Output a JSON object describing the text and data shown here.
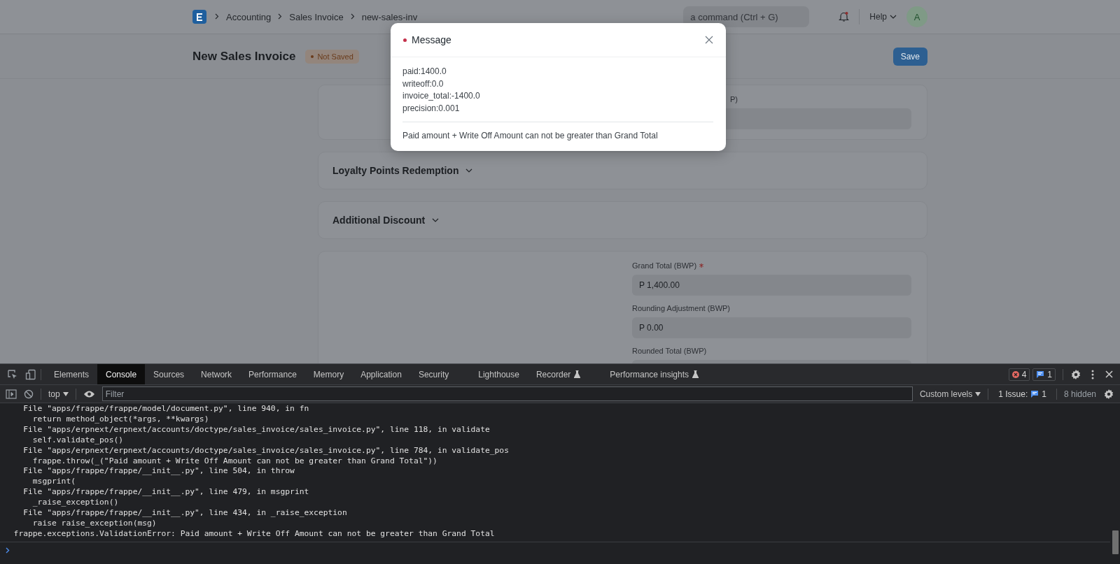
{
  "topbar": {
    "breadcrumbs": [
      "Accounting",
      "Sales Invoice",
      "new-sales-inv"
    ],
    "search": {
      "placeholder": "a command (Ctrl + G)"
    },
    "help": "Help",
    "avatar": "A"
  },
  "page_head": {
    "title": "New Sales Invoice",
    "status": "Not Saved",
    "save": "Save"
  },
  "sections": [
    {
      "kind": "fields",
      "fields": [
        {
          "label": "P)",
          "required": false
        }
      ]
    },
    {
      "kind": "collapsible",
      "title": "Loyalty Points Redemption",
      "expanded": false
    },
    {
      "kind": "collapsible",
      "title": "Additional Discount",
      "expanded": false
    },
    {
      "kind": "fields",
      "fields": [
        {
          "label": "Grand Total (BWP)",
          "required": true,
          "value": "P 1,400.00"
        },
        {
          "label": "Rounding Adjustment (BWP)",
          "required": false,
          "value": "P 0.00"
        },
        {
          "label": "Rounded Total (BWP)",
          "required": false
        }
      ]
    }
  ],
  "dialog": {
    "title": "Message",
    "lines": [
      "paid:1400.0",
      "writeoff:0.0",
      "invoice_total:-1400.0",
      "precision:0.001"
    ],
    "message": "Paid amount + Write Off Amount can not be greater than Grand Total"
  },
  "devtools": {
    "tabs": [
      {
        "label": "Elements",
        "selected": false,
        "experimental": false
      },
      {
        "label": "Console",
        "selected": true,
        "experimental": false
      },
      {
        "label": "Sources",
        "selected": false,
        "experimental": false
      },
      {
        "label": "Network",
        "selected": false,
        "experimental": false
      },
      {
        "label": "Performance",
        "selected": false,
        "experimental": false
      },
      {
        "label": "Memory",
        "selected": false,
        "experimental": false
      },
      {
        "label": "Application",
        "selected": false,
        "experimental": false
      },
      {
        "label": "Security",
        "selected": false,
        "experimental": false
      },
      {
        "label": "Lighthouse",
        "selected": false,
        "experimental": false
      },
      {
        "label": "Recorder",
        "selected": false,
        "experimental": true
      },
      {
        "label": "Performance insights",
        "selected": false,
        "experimental": true
      }
    ],
    "errors": "4",
    "messages": "1",
    "context": "top",
    "filter": {
      "placeholder": "Filter"
    },
    "levels": "Custom levels",
    "issues_label": "1 Issue:",
    "issues_count": "1",
    "hidden": "8 hidden",
    "console_lines": [
      "    File \"apps/frappe/frappe/model/document.py\", line 940, in fn",
      "      return method_object(*args, **kwargs)",
      "    File \"apps/erpnext/erpnext/accounts/doctype/sales_invoice/sales_invoice.py\", line 118, in validate",
      "      self.validate_pos()",
      "    File \"apps/erpnext/erpnext/accounts/doctype/sales_invoice/sales_invoice.py\", line 784, in validate_pos",
      "      frappe.throw(_(\"Paid amount + Write Off Amount can not be greater than Grand Total\"))",
      "    File \"apps/frappe/frappe/__init__.py\", line 504, in throw",
      "      msgprint(",
      "    File \"apps/frappe/frappe/__init__.py\", line 479, in msgprint",
      "      _raise_exception()",
      "    File \"apps/frappe/frappe/__init__.py\", line 434, in _raise_exception",
      "      raise raise_exception(msg)",
      "  frappe.exceptions.ValidationError: Paid amount + Write Off Amount can not be greater than Grand Total"
    ]
  }
}
